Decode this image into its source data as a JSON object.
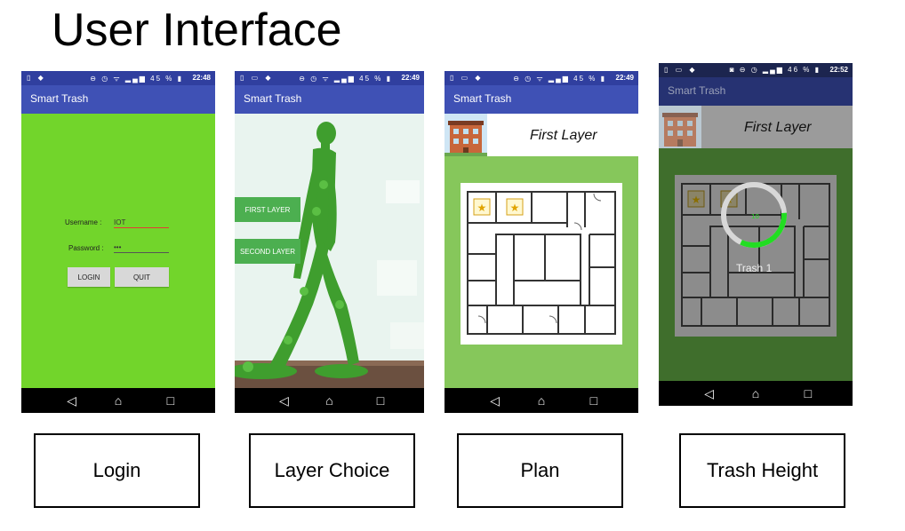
{
  "title": "User Interface",
  "app_name": "Smart Trash",
  "login": {
    "time": "22:48",
    "battery": "45 %",
    "username_label": "Username :",
    "username_value": "IOT",
    "password_label": "Password :",
    "password_value": "•••",
    "login_button": "LOGIN",
    "quit_button": "QUIT"
  },
  "layer_choice": {
    "time": "22:49",
    "battery": "45 %",
    "first_layer_button": "FIRST LAYER",
    "second_layer_button": "SECOND LAYER"
  },
  "plan": {
    "time": "22:49",
    "battery": "45 %",
    "layer_title": "First Layer"
  },
  "trash_height": {
    "time": "22:52",
    "battery": "46 %",
    "layer_title": "First Layer",
    "trash_label": "Trash 1",
    "fill_fraction": 0.33
  },
  "captions": [
    "Login",
    "Layer Choice",
    "Plan",
    "Trash Height"
  ],
  "colors": {
    "status_bar": "#303f9f",
    "app_bar": "#3f51b5",
    "login_bg": "#72d52b",
    "layer_button": "#4caf50",
    "plan_bg": "#86c75b",
    "gauge_green": "#22dd22"
  }
}
